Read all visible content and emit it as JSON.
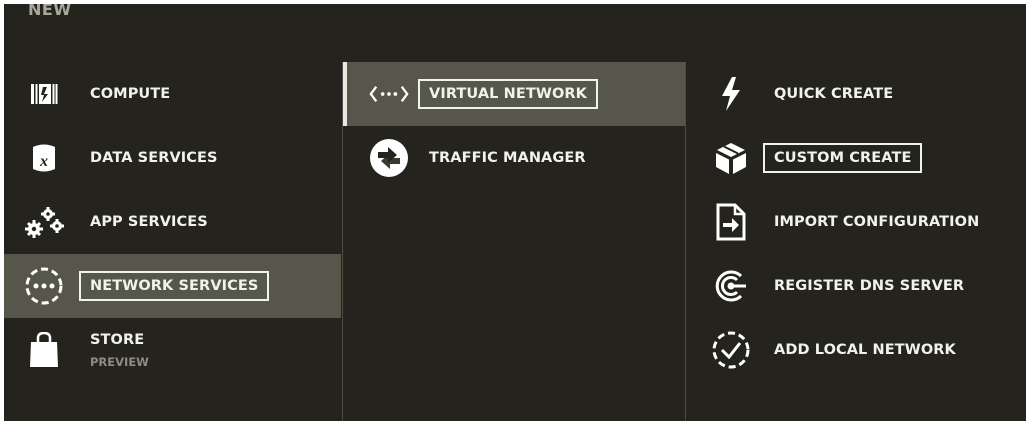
{
  "header": {
    "title": "NEW"
  },
  "column1": {
    "items": [
      {
        "label": "COMPUTE",
        "icon": "compute-icon"
      },
      {
        "label": "DATA SERVICES",
        "icon": "database-icon"
      },
      {
        "label": "APP SERVICES",
        "icon": "gears-icon"
      },
      {
        "label": "NETWORK SERVICES",
        "icon": "network-services-icon",
        "selected": true
      },
      {
        "label": "STORE",
        "sublabel": "PREVIEW",
        "icon": "shopping-bag-icon"
      }
    ]
  },
  "column2": {
    "items": [
      {
        "label": "VIRTUAL NETWORK",
        "icon": "virtual-network-icon",
        "selected": true
      },
      {
        "label": "TRAFFIC MANAGER",
        "icon": "traffic-manager-icon"
      }
    ]
  },
  "column3": {
    "items": [
      {
        "label": "QUICK CREATE",
        "icon": "lightning-icon"
      },
      {
        "label": "CUSTOM CREATE",
        "icon": "box-icon"
      },
      {
        "label": "IMPORT CONFIGURATION",
        "icon": "import-icon"
      },
      {
        "label": "REGISTER DNS SERVER",
        "icon": "dns-icon"
      },
      {
        "label": "ADD LOCAL NETWORK",
        "icon": "local-network-icon"
      }
    ]
  }
}
